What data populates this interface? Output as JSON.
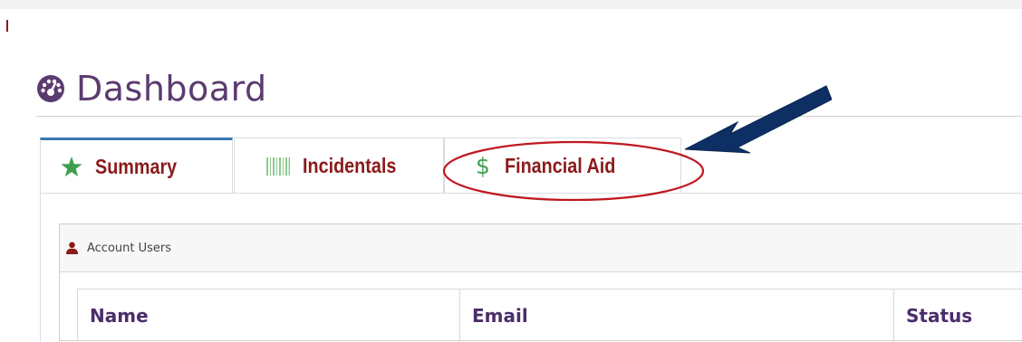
{
  "page": {
    "title": "Dashboard",
    "title_icon": "dashboard-gauge-icon"
  },
  "tabs": [
    {
      "label": "Summary",
      "icon": "star-icon",
      "icon_color": "#3f9e4f",
      "active": true
    },
    {
      "label": "Incidentals",
      "icon": "barcode-icon",
      "icon_color": "#8fc98f",
      "active": false
    },
    {
      "label": "Financial Aid",
      "icon": "dollar-icon",
      "icon_glyph": "$",
      "icon_color": "#3f9e4f",
      "active": false
    }
  ],
  "annotation": {
    "highlight": "red-ellipse-around-financial-aid-tab",
    "highlight_color": "#c0181f",
    "arrow_color": "#0e2f63"
  },
  "panel": {
    "title": "Account Users",
    "icon": "user-icon",
    "table": {
      "columns": [
        "Name",
        "Email",
        "Status"
      ]
    }
  },
  "colors": {
    "title": "#5b3b6f",
    "tab_label": "#8b1a1a",
    "table_header": "#4a2d6b",
    "active_tab_accent": "#3a79b3"
  }
}
